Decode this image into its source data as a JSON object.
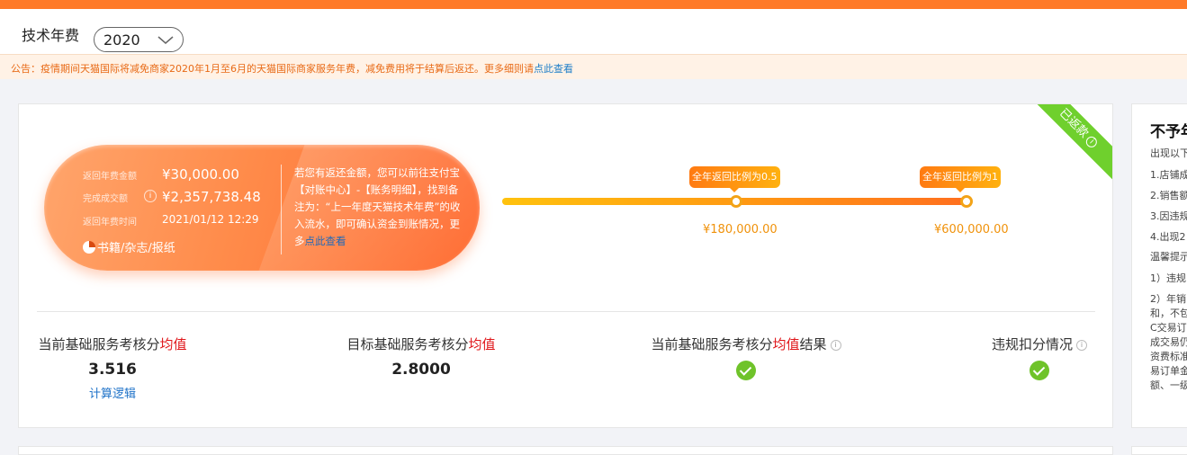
{
  "header": {
    "title": "技术年费",
    "year_selected": "2020"
  },
  "notice": {
    "text": "公告：疫情期间天猫国际将减免商家2020年1月至6月的天猫国际商家服务年费，减免费用将于结算后返还。更多细则请",
    "link": "点此查看"
  },
  "status_ribbon": {
    "label": "已返款",
    "info": "i"
  },
  "refund_card": {
    "rows": [
      {
        "label": "返回年费金额",
        "value": "¥30,000.00"
      },
      {
        "label": "完成成交额",
        "value": "¥2,357,738.48"
      },
      {
        "label": "返回年费时间",
        "value": "2021/01/12 12:29"
      }
    ],
    "info_icon": "i",
    "category": "书籍/杂志/报纸",
    "tip_text": "若您有返还金额，您可以前往支付宝【对账中心】-【账务明细】，找到备注为：“上一年度天猫技术年费”的收入流水，即可确认资金到账情况，更多",
    "tip_link": "点此查看"
  },
  "progress": {
    "milestones": [
      {
        "tag": "全年返回比例为0.5",
        "amount": "¥180,000.00"
      },
      {
        "tag": "全年返回比例为1",
        "amount": "¥600,000.00"
      }
    ],
    "accent": "#ff8a14"
  },
  "metrics": [
    {
      "title_a": "当前基础服务考核分",
      "title_em": "均值",
      "title_b": "",
      "value": "3.516",
      "link": "计算逻辑"
    },
    {
      "title_a": "目标基础服务考核分",
      "title_em": "均值",
      "title_b": "",
      "value": "2.8000"
    },
    {
      "title_a": "当前基础服务考核分",
      "title_em": "均值",
      "title_b": "结果",
      "status": "check-icon"
    },
    {
      "title_a": "违规扣分情况",
      "title_em": "",
      "title_b": "",
      "status": "check-icon"
    }
  ],
  "side": {
    "title": "不予年",
    "lines": [
      "出现以下",
      "1.店铺成",
      "2.销售额",
      "3.因违规",
      "4.出现2",
      "温馨提示",
      "1）违规",
      "2）年销",
      "和，不包",
      "C交易订",
      "成交易仍",
      "资费标准",
      "易订单金",
      "额、一级"
    ]
  }
}
